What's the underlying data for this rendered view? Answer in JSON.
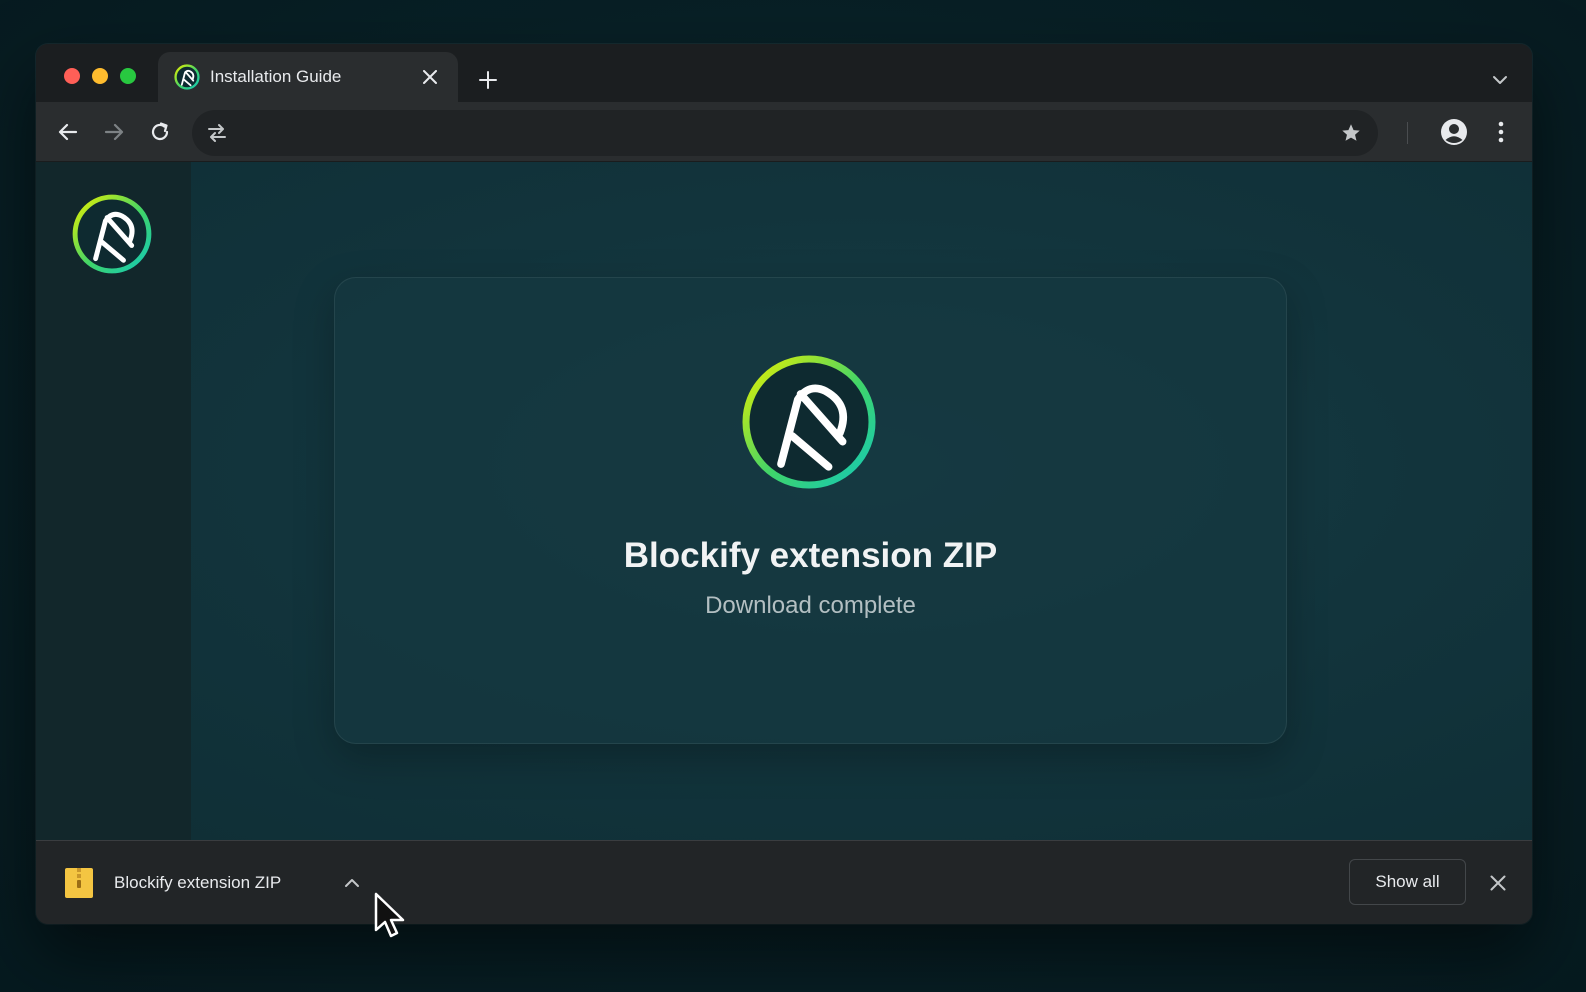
{
  "tab": {
    "title": "Installation Guide"
  },
  "omnibox": {
    "url": "",
    "placeholder": ""
  },
  "card": {
    "title": "Blockify extension ZIP",
    "subtitle": "Download complete"
  },
  "download_shelf": {
    "item_name": "Blockify extension ZIP",
    "show_all_label": "Show all"
  },
  "icons": {
    "favicon": "blockify-logo-icon",
    "tab_close": "close-icon",
    "new_tab": "plus-icon",
    "tab_search": "chevron-down-icon",
    "back": "arrow-left-icon",
    "forward": "arrow-right-icon",
    "reload": "reload-icon",
    "site_info": "tune-icon",
    "bookmark": "star-icon",
    "profile": "account-icon",
    "menu": "kebab-menu-icon",
    "download_file": "zip-file-icon",
    "shelf_close": "close-icon"
  },
  "colors": {
    "logo_gradient_start": "#e8f000",
    "logo_gradient_end": "#14c8b8",
    "page_background": "#12343c",
    "traffic_red": "#ff5f57",
    "traffic_yellow": "#febc2e",
    "traffic_green": "#28c840"
  }
}
